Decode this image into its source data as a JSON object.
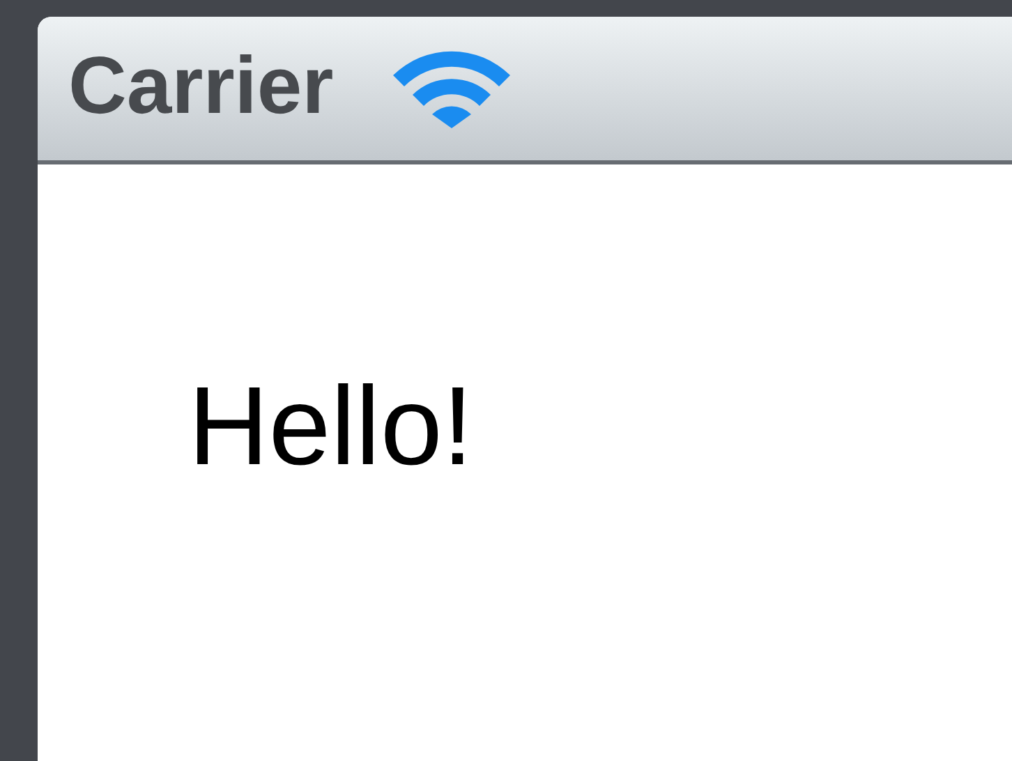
{
  "status_bar": {
    "carrier": "Carrier"
  },
  "content": {
    "label": "Hello!"
  }
}
